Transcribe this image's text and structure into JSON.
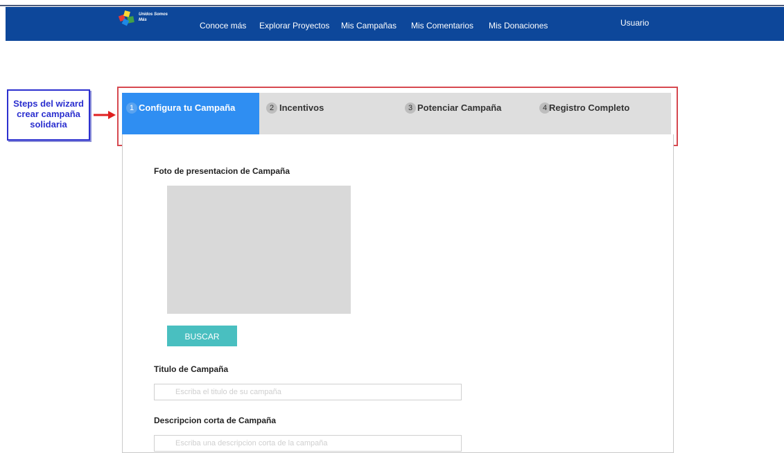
{
  "brand": {
    "logo_text": "Unidos Somos Más"
  },
  "nav": {
    "items": [
      "Conoce más",
      "Explorar Proyectos",
      "Mis Campañas",
      "Mis Comentarios",
      "Mis Donaciones"
    ],
    "user": "Usuario"
  },
  "annotation": {
    "text": "Steps del wizard crear campaña solidaria"
  },
  "wizard": {
    "steps": [
      {
        "num": "1",
        "label": "Configura tu Campaña",
        "active": true
      },
      {
        "num": "2",
        "label": "Incentivos",
        "active": false
      },
      {
        "num": "3",
        "label": "Potenciar Campaña",
        "active": false
      },
      {
        "num": "4",
        "label": "Registro Completo",
        "active": false
      }
    ]
  },
  "form": {
    "photo_label": "Foto de presentacion de Campaña",
    "buscar_label": "BUSCAR",
    "title_label": "Titulo de Campaña",
    "title_placeholder": "Escriba el titulo de su campaña",
    "desc_label": "Descripcion corta de Campaña",
    "desc_placeholder": "Escriba una descripcion corta de la campaña"
  },
  "colors": {
    "navbar": "#0d479a",
    "active_step": "#2f8ef2",
    "buscar_button": "#49bfc0",
    "annotation_frame": "#d6484f"
  }
}
